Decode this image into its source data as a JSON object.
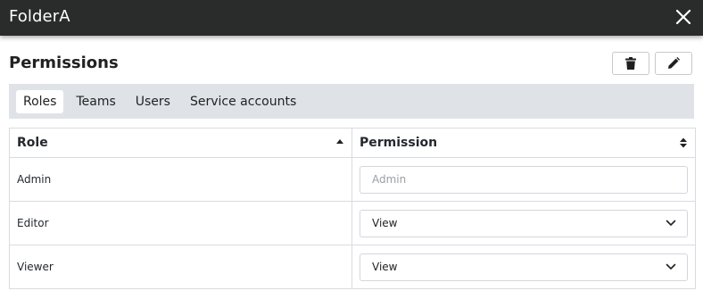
{
  "window": {
    "title": "FolderA",
    "close_icon": "close-icon"
  },
  "section": {
    "title": "Permissions"
  },
  "toolbar": {
    "delete_icon": "trash-icon",
    "edit_icon": "pencil-icon"
  },
  "tabs": [
    {
      "label": "Roles",
      "active": true
    },
    {
      "label": "Teams",
      "active": false
    },
    {
      "label": "Users",
      "active": false
    },
    {
      "label": "Service accounts",
      "active": false
    }
  ],
  "table": {
    "columns": [
      "Role",
      "Permission"
    ],
    "rows": [
      {
        "role": "Admin",
        "permission": "Admin",
        "editable": false
      },
      {
        "role": "Editor",
        "permission": "View",
        "editable": true
      },
      {
        "role": "Viewer",
        "permission": "View",
        "editable": true
      }
    ]
  }
}
